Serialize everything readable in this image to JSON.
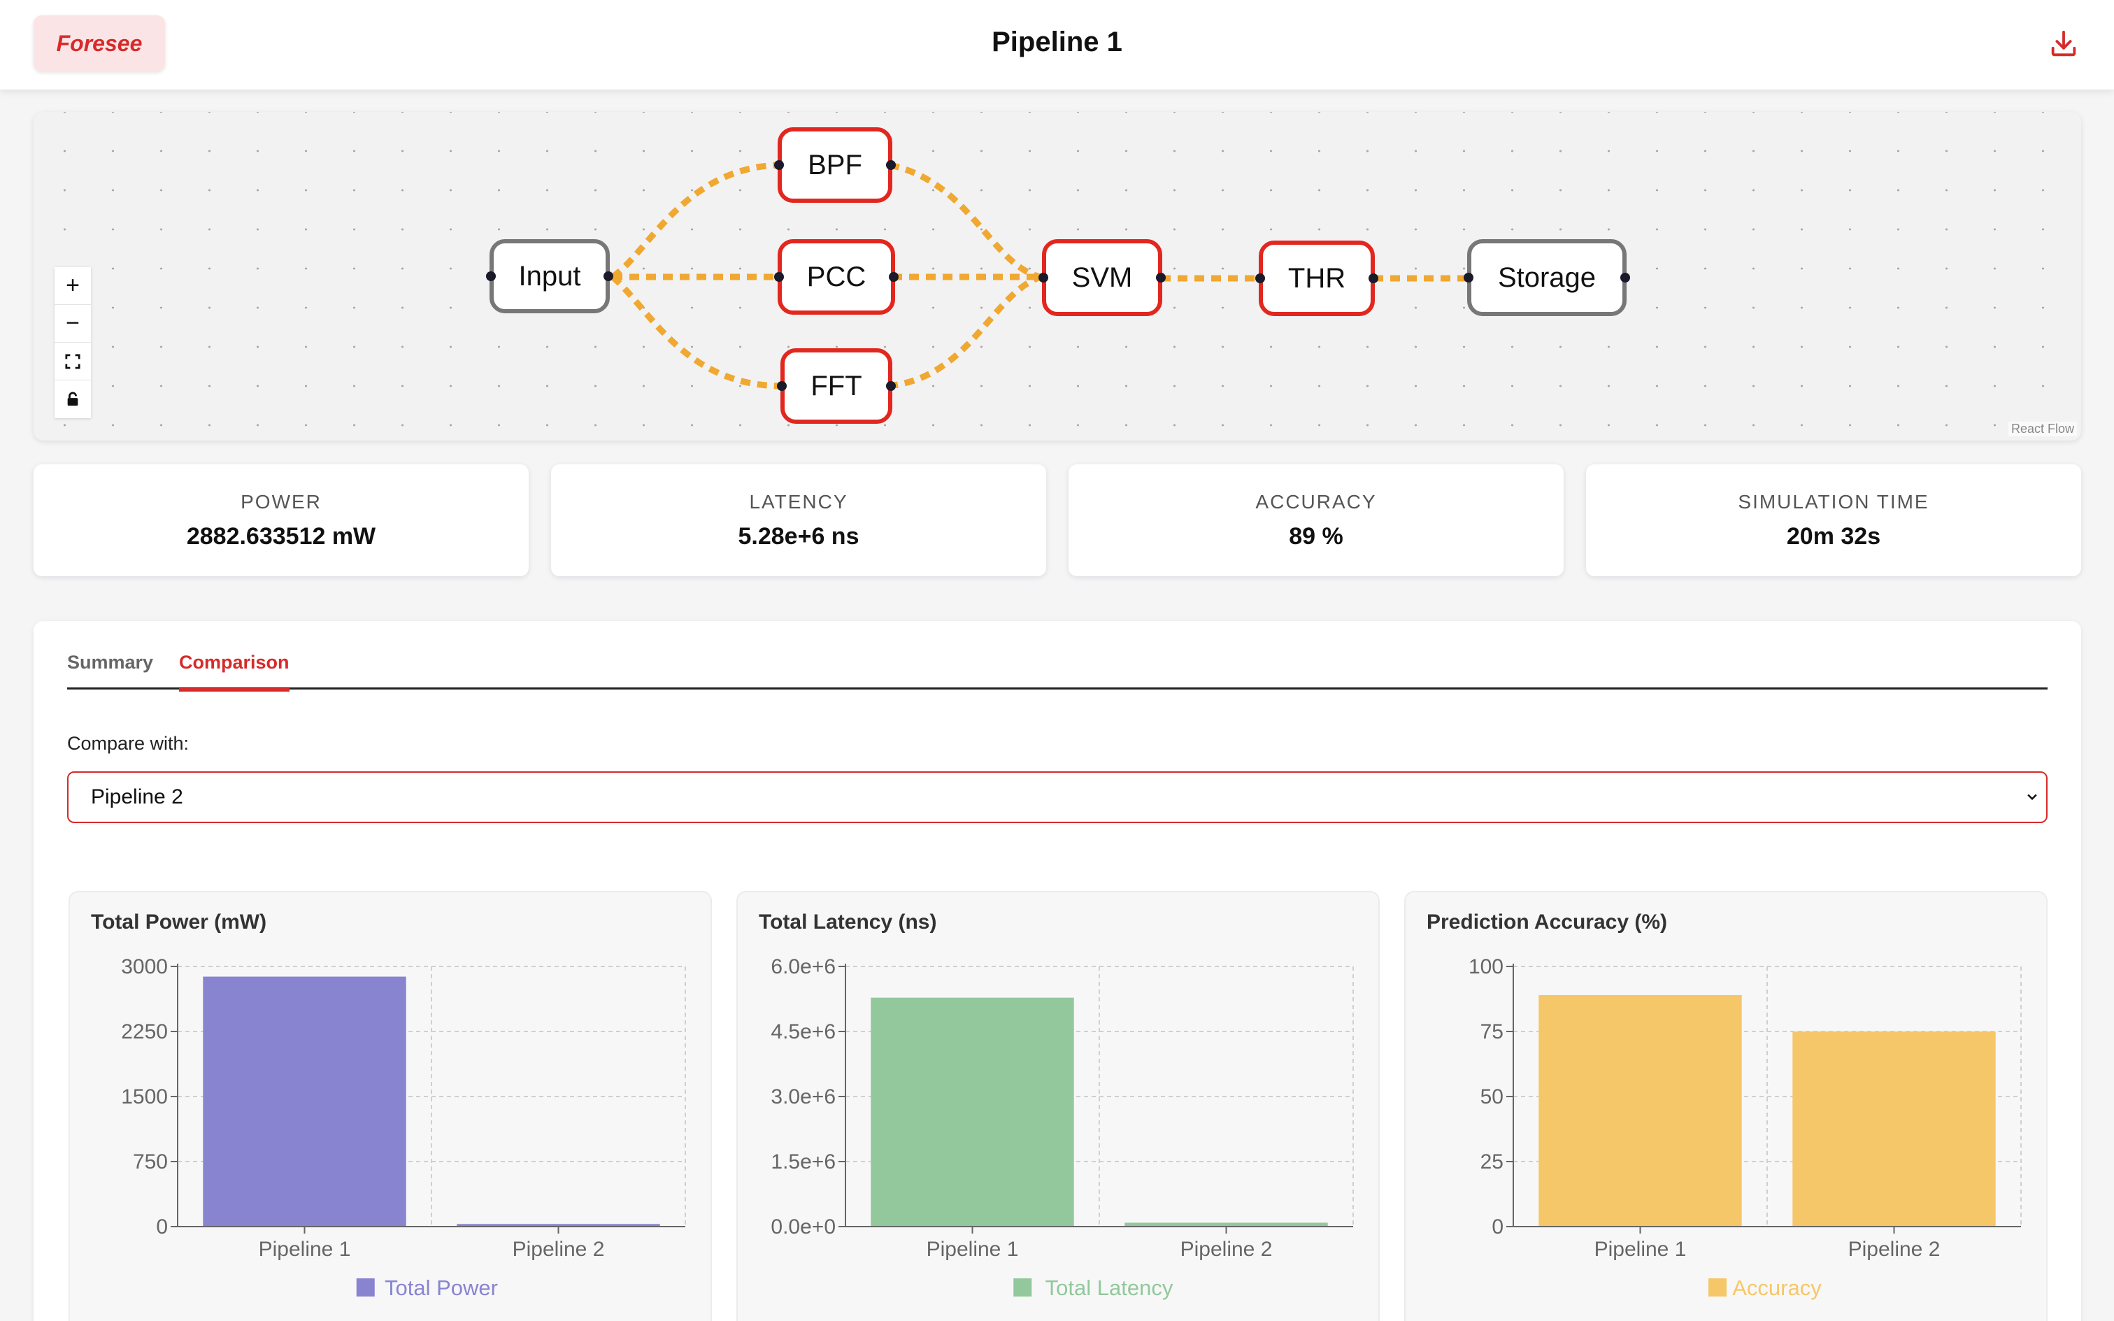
{
  "header": {
    "logo": "Foresee",
    "title": "Pipeline 1",
    "download_icon": "download-icon"
  },
  "flow": {
    "nodes": {
      "input": "Input",
      "bpf": "BPF",
      "pcc": "PCC",
      "fft": "FFT",
      "svm": "SVM",
      "thr": "THR",
      "storage": "Storage"
    },
    "controls": {
      "zoom_in": "+",
      "zoom_out": "−",
      "fit": "fit-view-icon",
      "lock": "lock-icon"
    },
    "attribution": "React Flow",
    "edge_color": "#f0a830",
    "node_border_active": "#e2271f",
    "node_border_inactive": "#777777"
  },
  "metrics": [
    {
      "label": "POWER",
      "value": "2882.633512 mW"
    },
    {
      "label": "LATENCY",
      "value": "5.28e+6 ns"
    },
    {
      "label": "ACCURACY",
      "value": "89 %"
    },
    {
      "label": "SIMULATION TIME",
      "value": "20m 32s"
    }
  ],
  "tabs": {
    "summary": "Summary",
    "comparison": "Comparison",
    "active": "Comparison"
  },
  "compare": {
    "label": "Compare with:",
    "selected": "Pipeline 2"
  },
  "chart_data": [
    {
      "type": "bar",
      "title": "Total Power (mW)",
      "categories": [
        "Pipeline 1",
        "Pipeline 2"
      ],
      "series": [
        {
          "name": "Total Power",
          "values": [
            2882.633512,
            30
          ],
          "color": "#8884d0"
        }
      ],
      "yticks": [
        "0",
        "750",
        "1500",
        "2250",
        "3000"
      ],
      "ylim": [
        0,
        3000
      ],
      "grid": true,
      "legend": "bottom"
    },
    {
      "type": "bar",
      "title": "Total Latency (ns)",
      "categories": [
        "Pipeline 1",
        "Pipeline 2"
      ],
      "series": [
        {
          "name": "Total Latency",
          "values": [
            5280000,
            90000
          ],
          "color": "#92c89c"
        }
      ],
      "yticks": [
        "0.0e+0",
        "1.5e+6",
        "3.0e+6",
        "4.5e+6",
        "6.0e+6"
      ],
      "ylim": [
        0,
        6000000
      ],
      "grid": true,
      "legend": "bottom"
    },
    {
      "type": "bar",
      "title": "Prediction Accuracy (%)",
      "categories": [
        "Pipeline 1",
        "Pipeline 2"
      ],
      "series": [
        {
          "name": "Accuracy",
          "values": [
            89,
            75
          ],
          "color": "#f6c768"
        }
      ],
      "yticks": [
        "0",
        "25",
        "50",
        "75",
        "100"
      ],
      "ylim": [
        0,
        100
      ],
      "grid": true,
      "legend": "bottom"
    }
  ]
}
